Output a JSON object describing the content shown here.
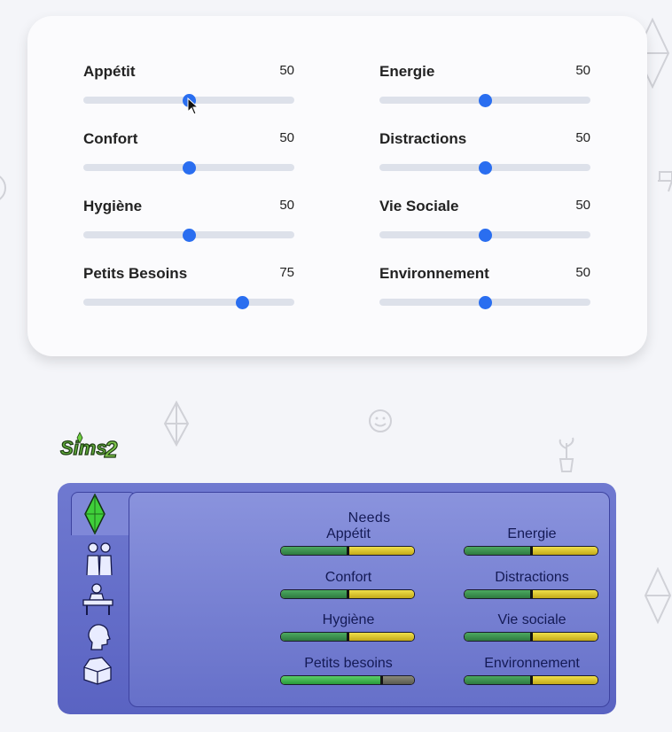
{
  "controls": [
    {
      "label": "Appétit",
      "value": 50
    },
    {
      "label": "Energie",
      "value": 50
    },
    {
      "label": "Confort",
      "value": 50
    },
    {
      "label": "Distractions",
      "value": 50
    },
    {
      "label": "Hygiène",
      "value": 50
    },
    {
      "label": "Vie Sociale",
      "value": 50
    },
    {
      "label": "Petits Besoins",
      "value": 75
    },
    {
      "label": "Environnement",
      "value": 50
    }
  ],
  "logo": {
    "text": "SIMS 2",
    "color": "#5fa83a"
  },
  "needs_panel": {
    "title": "Needs",
    "tabs": [
      "plumbob-icon",
      "relationships-icon",
      "career-icon",
      "personality-icon",
      "inventory-icon"
    ],
    "needs": [
      {
        "label": "Appétit",
        "value": 50
      },
      {
        "label": "Energie",
        "value": 50
      },
      {
        "label": "Confort",
        "value": 50
      },
      {
        "label": "Distractions",
        "value": 50
      },
      {
        "label": "Hygiène",
        "value": 50
      },
      {
        "label": "Vie sociale",
        "value": 50
      },
      {
        "label": "Petits besoins",
        "value": 75
      },
      {
        "label": "Environnement",
        "value": 50
      }
    ]
  },
  "colors": {
    "slider_thumb": "#2a6ef0",
    "slider_track": "#dde1ea",
    "panel_blue": "#5a63c2",
    "bar_green": "#2e7a40",
    "bar_yellow": "#d4c02a",
    "plumbob_green": "#3fcf3a"
  }
}
